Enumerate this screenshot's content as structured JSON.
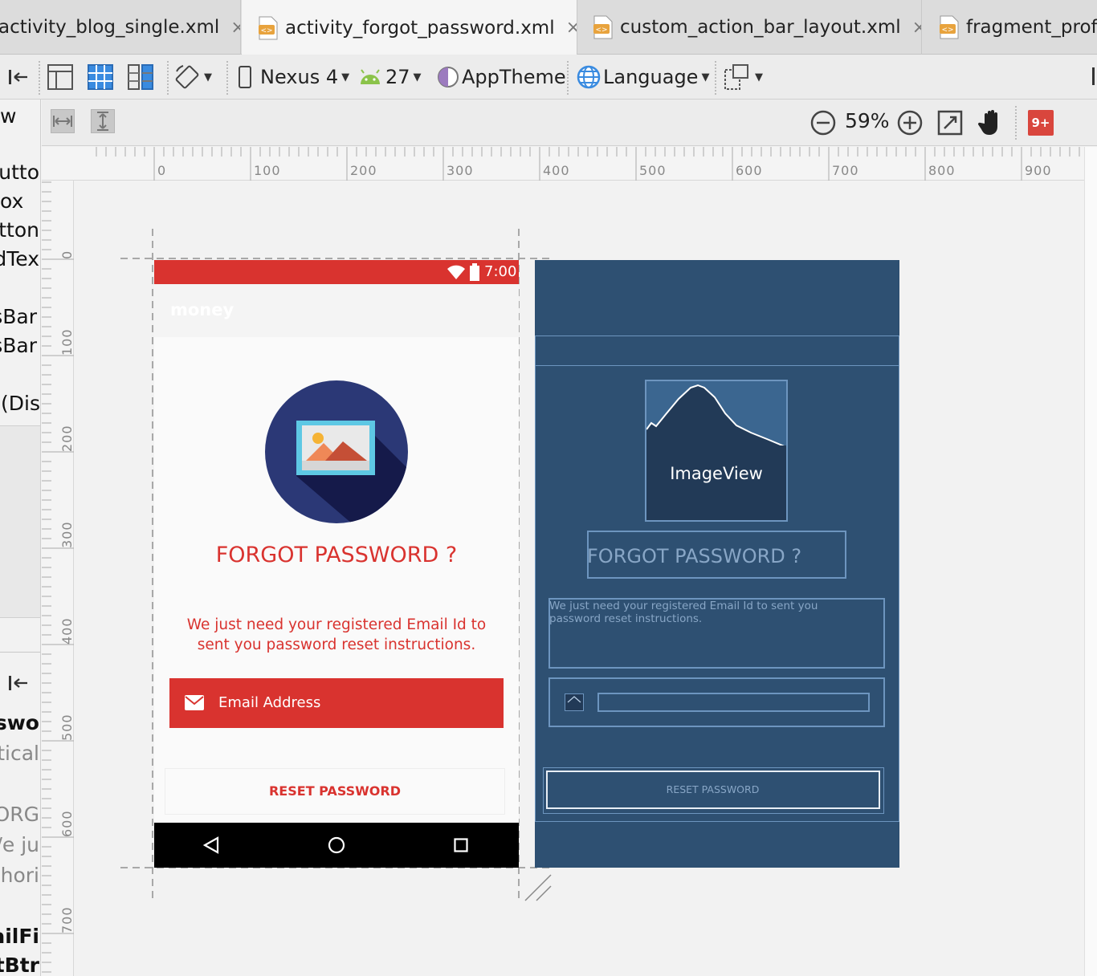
{
  "tabs": [
    {
      "label": "activity_blog_single.xml",
      "close": "×"
    },
    {
      "label": "activity_forgot_password.xml",
      "close": "×"
    },
    {
      "label": "custom_action_bar_layout.xml",
      "close": "×"
    },
    {
      "label": "fragment_profi"
    }
  ],
  "toolbar": {
    "device": "Nexus 4",
    "api": "27",
    "theme": "AppTheme",
    "language": "Language",
    "zoom": "59%",
    "gplus": "9+"
  },
  "ruler": {
    "h": [
      "0",
      "100",
      "200",
      "300",
      "400",
      "500",
      "600",
      "700",
      "800",
      "900"
    ],
    "v": [
      "0",
      "100",
      "200",
      "300",
      "400",
      "500",
      "600",
      "700"
    ]
  },
  "left_panel": {
    "top_fragments": [
      "w",
      "utto",
      "ox",
      "tton",
      "dTex",
      "sBar",
      "sBar",
      "(Dis"
    ],
    "bottom_fragments": [
      "sswo",
      "tical",
      "ORG",
      "/e ju",
      "hori",
      "ailFi",
      "tBtr"
    ]
  },
  "phone": {
    "time": "7:00",
    "app_title": "money",
    "heading": "FORGOT PASSWORD ?",
    "message": "We just need your registered Email Id to sent you password reset instructions.",
    "email_placeholder": "Email Address",
    "reset_button": "RESET PASSWORD"
  },
  "blueprint": {
    "imageview_label": "ImageView",
    "heading": "FORGOT PASSWORD ?",
    "message": "We just need your registered Email Id to sent you password reset instructions.",
    "reset_button": "RESET PASSWORD"
  },
  "colors": {
    "accent_red": "#d9332f",
    "blueprint_bg": "#2e5072",
    "blueprint_line": "#6d95bf"
  }
}
